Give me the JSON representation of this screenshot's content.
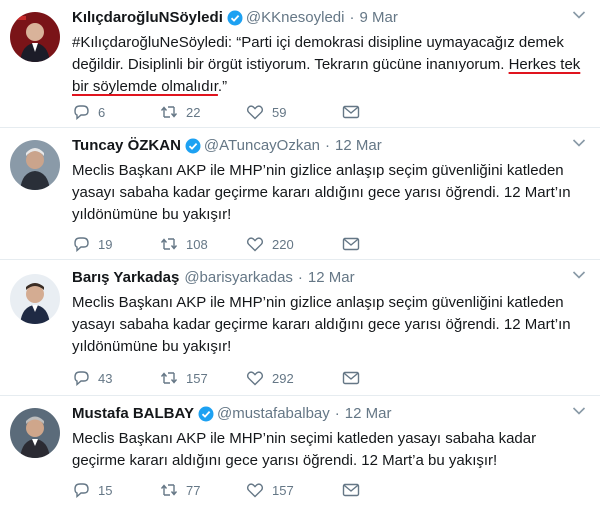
{
  "tweets": [
    {
      "name": "KılıçdaroğluNSöyledi",
      "handle": "@KKnesoyledi",
      "time": "9 Mar",
      "text_before": "#KılıçdaroğluNeSöyledi: “Parti içi demokrasi disipline uymayacağız demek değildir. Disiplinli bir örgüt istiyorum. Tekrarın gücüne inanıyorum. ",
      "text_highlight": "Herkes tek bir söylemde olmalıdır",
      "text_after": ".”",
      "replies": "6",
      "retweets": "22",
      "likes": "59"
    },
    {
      "name": "Tuncay ÖZKAN",
      "handle": "@ATuncayOzkan",
      "time": "12 Mar",
      "text": "Meclis Başkanı AKP ile MHP’nin gizlice anlaşıp seçim güvenliğini katleden yasayı sabaha kadar geçirme kararı aldığını gece yarısı öğrendi. 12 Mart’ın yıldönümüne bu yakışır!",
      "replies": "19",
      "retweets": "108",
      "likes": "220"
    },
    {
      "name": "Barış Yarkadaş",
      "handle": "@barisyarkadas",
      "time": "12 Mar",
      "text": "Meclis Başkanı AKP ile MHP’nin gizlice anlaşıp seçim güvenliğini katleden yasayı sabaha kadar geçirme kararı aldığını gece yarısı öğrendi. 12 Mart’ın yıldönümüne bu yakışır!",
      "replies": "43",
      "retweets": "157",
      "likes": "292"
    },
    {
      "name": "Mustafa BALBAY",
      "handle": "@mustafabalbay",
      "time": "12 Mar",
      "text": "Meclis Başkanı AKP ile MHP’nin seçimi katleden yasayı sabaha kadar geçirme kararı aldığını gece yarısı öğrendi. 12 Mart’a bu yakışır!",
      "replies": "15",
      "retweets": "77",
      "likes": "157"
    }
  ],
  "icons": {
    "verified": "verified-badge-icon",
    "reply": "reply-icon",
    "retweet": "retweet-icon",
    "like": "heart-icon",
    "dm": "envelope-icon",
    "more": "chevron-down-icon"
  },
  "colors": {
    "verified": "#1da1f2",
    "secondary_text": "#657786",
    "highlight_underline": "#e0141e"
  }
}
